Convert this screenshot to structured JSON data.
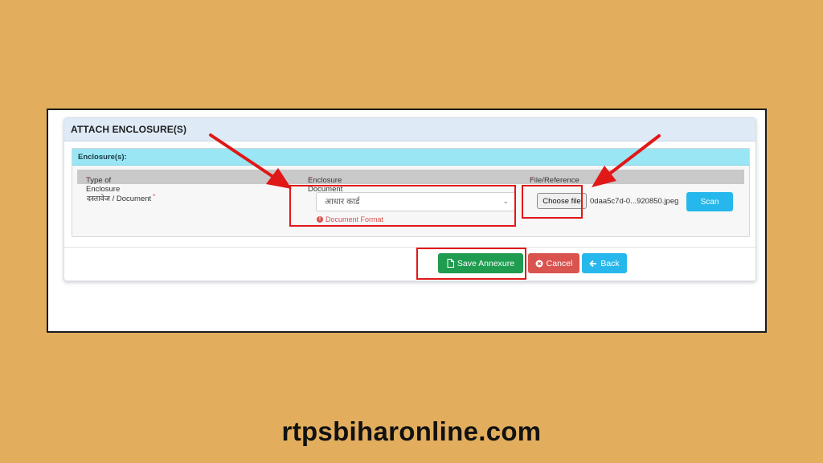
{
  "panel": {
    "title": "ATTACH ENCLOSURE(S)"
  },
  "enclosures": {
    "header": "Enclosure(s):",
    "columns": {
      "type": "Type of Enclosure",
      "document": "Enclosure Document",
      "file": "File/Reference",
      "required_marker": "*"
    },
    "row": {
      "type_label": "दस्तावेज / Document",
      "selected_document": "आधार कार्ड",
      "document_format": "Document Format",
      "choose_file_label": "Choose file",
      "file_name": "0daa5c7d-0...920850.jpeg",
      "scan_label": "Scan"
    }
  },
  "actions": {
    "save": "Save Annexure",
    "cancel": "Cancel",
    "back": "Back"
  },
  "footer": {
    "site": "rtpsbiharonline.com"
  },
  "colors": {
    "background": "#E2AE5E",
    "highlight": "#e01818",
    "save": "#1f9c50",
    "cancel": "#d9534f",
    "info": "#26b8ec",
    "section_header": "#9ae6f5"
  },
  "icons": [
    "file-icon",
    "cancel-circle-icon",
    "back-arrow-icon",
    "info-icon",
    "chevron-down-icon"
  ]
}
